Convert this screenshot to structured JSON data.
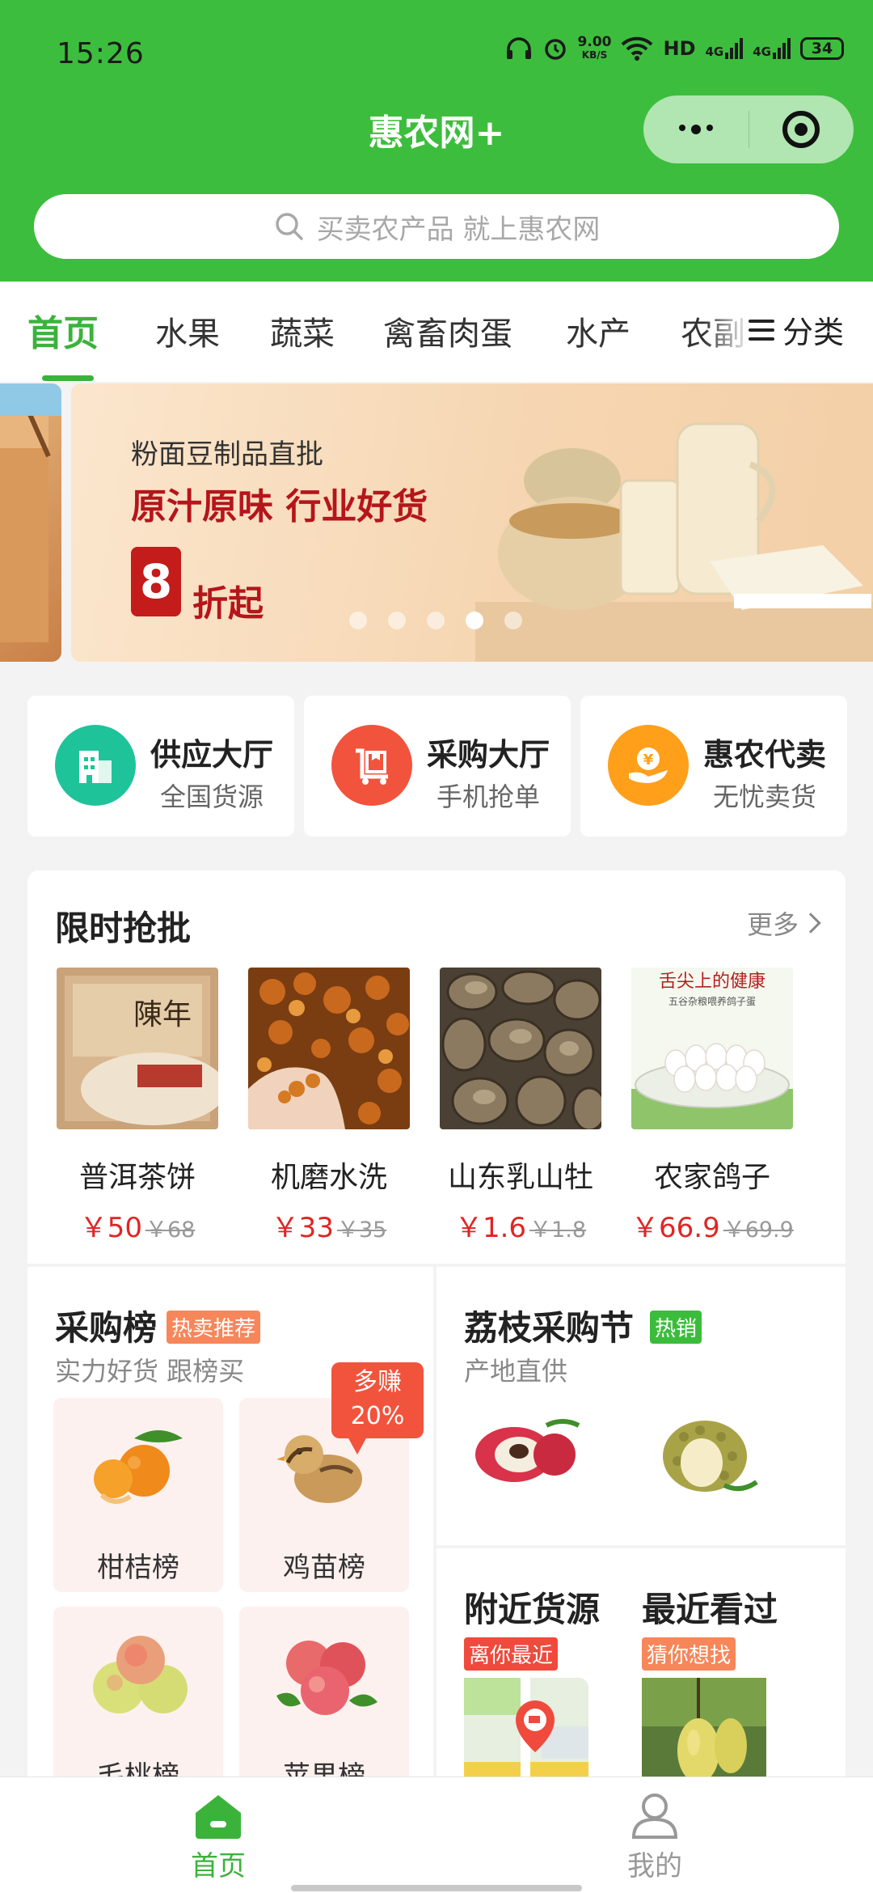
{
  "status_bar": {
    "time": "15:26",
    "net_speed_value": "9.00",
    "net_speed_unit": "KB/S",
    "hd_label": "HD",
    "signal_labels": [
      "4G",
      "4G"
    ],
    "battery": "34"
  },
  "header": {
    "title": "惠农网+",
    "search_placeholder": "买卖农产品 就上惠农网",
    "brand_color": "#3dbd3d"
  },
  "category_tabs": {
    "items": [
      "首页",
      "水果",
      "蔬菜",
      "禽畜肉蛋",
      "水产",
      "农副"
    ],
    "active_index": 0,
    "classify_label": "分类"
  },
  "banner": {
    "subtitle": "粉面豆制品直批",
    "headline": "原汁原味 行业好货",
    "discount_number": "8",
    "discount_suffix": "折起",
    "dot_count": 5,
    "active_dot": 3
  },
  "feature_cards": [
    {
      "title": "供应大厅",
      "subtitle": "全国货源",
      "icon": "building-icon",
      "color": "#1fc39a"
    },
    {
      "title": "采购大厅",
      "subtitle": "手机抢单",
      "icon": "cart-icon",
      "color": "#f2533c"
    },
    {
      "title": "惠农代卖",
      "subtitle": "无忧卖货",
      "icon": "yuan-hand-icon",
      "color": "#ff9f1a"
    }
  ],
  "flash_sale": {
    "title": "限时抢批",
    "more_label": "更多",
    "products": [
      {
        "name": "普洱茶饼",
        "price": "￥50",
        "original_price": "￥68"
      },
      {
        "name": "机磨水洗",
        "price": "￥33",
        "original_price": "￥35"
      },
      {
        "name": "山东乳山牡",
        "price": "￥1.6",
        "original_price": "￥1.8"
      },
      {
        "name": "农家鸽子",
        "price": "￥66.9",
        "original_price": "￥69.9"
      }
    ],
    "egg_image_text": "舌尖上的健康",
    "egg_image_subtext": "五谷杂粮喂养鸽子蛋",
    "tea_image_text": "陳年"
  },
  "purchase_rank": {
    "title": "采购榜",
    "tag": "热卖推荐",
    "subtitle": "实力好货 跟榜买",
    "earn_badge_line1": "多赚",
    "earn_badge_line2": "20%",
    "items": [
      "柑桔榜",
      "鸡苗榜",
      "毛桃榜",
      "苹果榜"
    ]
  },
  "lychee_festival": {
    "title": "荔枝采购节",
    "tag": "热销",
    "subtitle": "产地直供"
  },
  "nearby": {
    "title": "附近货源",
    "tag": "离你最近"
  },
  "recent": {
    "title": "最近看过",
    "tag": "猜你想找"
  },
  "bottom_nav": {
    "items": [
      {
        "label": "首页",
        "icon": "home-icon",
        "active": true
      },
      {
        "label": "我的",
        "icon": "user-icon",
        "active": false
      }
    ]
  }
}
